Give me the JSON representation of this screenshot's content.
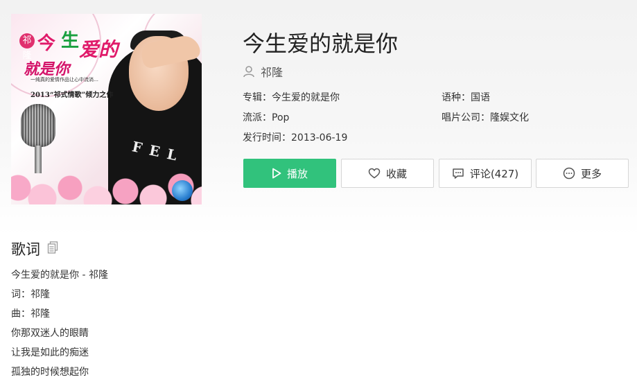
{
  "song": {
    "title": "今生爱的就是你",
    "artist": "祁隆"
  },
  "meta": {
    "album_label": "专辑：",
    "album": "今生爱的就是你",
    "language_label": "语种：",
    "language": "国语",
    "genre_label": "流派：",
    "genre": "Pop",
    "label_label": "唱片公司：",
    "label": "隆娱文化",
    "release_label": "发行时间：",
    "release_date": "2013-06-19"
  },
  "cover_art": {
    "name_badge": "祁隆",
    "title_chars": [
      "今",
      "生",
      "爱的",
      "就是你"
    ],
    "tagline": "一纯真的爱情作品让心中流淌…",
    "subtitle": "2013“祁式情歌”倾力之作"
  },
  "actions": {
    "play": "播放",
    "favorite": "收藏",
    "comments": "评论(427)",
    "more": "更多"
  },
  "lyrics": {
    "heading": "歌词",
    "lines": [
      "今生爱的就是你 - 祁隆",
      "词：祁隆",
      "曲：祁隆",
      "你那双迷人的眼睛",
      "让我是如此的痴迷",
      "孤独的时候想起你"
    ]
  },
  "colors": {
    "accent": "#31c27c",
    "button_border": "#d6d6d6",
    "text": "#333333"
  },
  "icons": {
    "artist": "user-icon",
    "play": "play-icon",
    "favorite": "heart-icon",
    "comments": "comment-icon",
    "more": "more-icon",
    "copy": "copy-icon"
  }
}
